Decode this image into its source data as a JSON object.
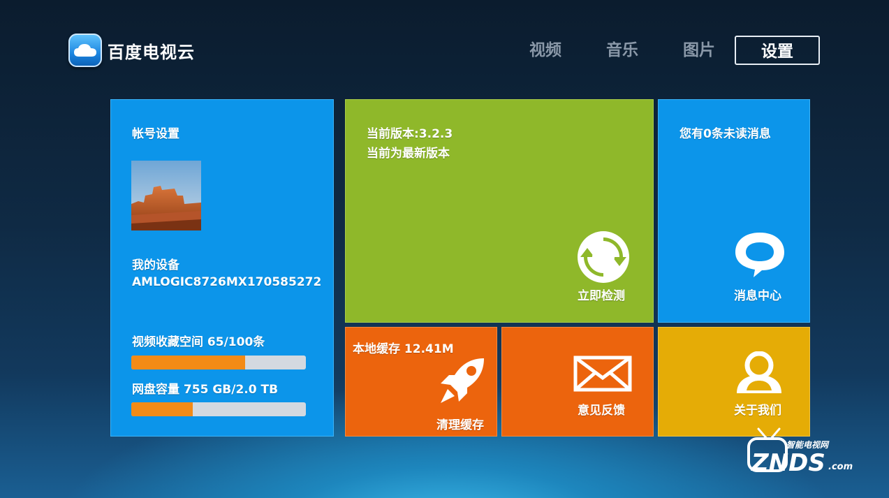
{
  "app": {
    "logo_text": "百度电视云"
  },
  "nav": {
    "tabs": [
      {
        "label": "视频",
        "active": false
      },
      {
        "label": "音乐",
        "active": false
      },
      {
        "label": "图片",
        "active": false
      },
      {
        "label": "设置",
        "active": true
      }
    ]
  },
  "account_tile": {
    "title": "帐号设置",
    "device_label": "我的设备",
    "device_id": "AMLOGIC8726MX170585272",
    "video_storage_label": "视频收藏空间 65/100条",
    "video_storage_fraction": 0.65,
    "disk_label": "网盘容量 755 GB/2.0 TB",
    "disk_fraction": 0.3525
  },
  "version_tile": {
    "version": "当前版本:3.2.3",
    "status": "当前为最新版本",
    "action": "立即检测",
    "icon": "refresh-icon"
  },
  "message_tile": {
    "unread": "您有0条未读消息",
    "action": "消息中心",
    "icon": "speech-bubble-icon"
  },
  "cache_tile": {
    "size": "本地缓存 12.41M",
    "action": "清理缓存",
    "icon": "rocket-icon"
  },
  "feedback_tile": {
    "action": "意见反馈",
    "icon": "envelope-icon"
  },
  "about_tile": {
    "action": "关于我们",
    "icon": "user-icon"
  },
  "watermark": {
    "line1": "智能电视网",
    "line2": "ZNDS",
    "line3": ".com"
  },
  "colors": {
    "blue_tile": "#0c95ea",
    "green_tile": "#8fb82a",
    "orange_tile": "#ec640d",
    "yellow_tile": "#e5ac06",
    "progress": "#f38b16"
  }
}
